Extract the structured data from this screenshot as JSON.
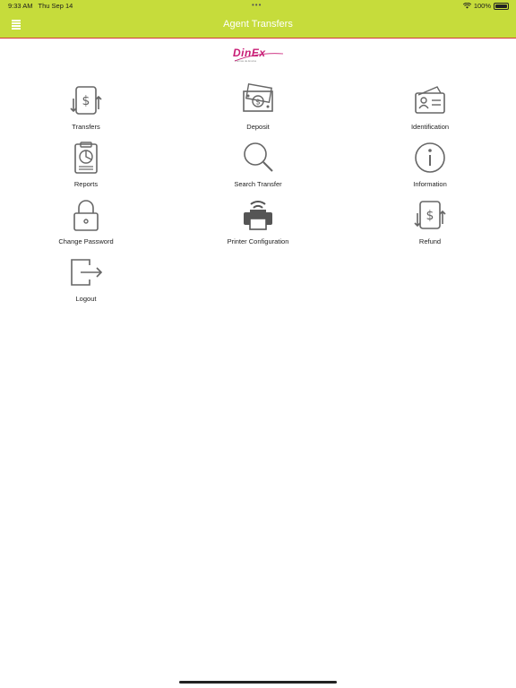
{
  "status_bar": {
    "time": "9:33 AM",
    "date": "Thu Sep 14",
    "battery": "100%"
  },
  "nav": {
    "title": "Agent Transfers"
  },
  "logo": {
    "text": "DinEx",
    "tagline": "Formas de Envios"
  },
  "menu": [
    {
      "label": "Transfers",
      "icon": "transfer-dollar-icon"
    },
    {
      "label": "Deposit",
      "icon": "cash-deposit-icon"
    },
    {
      "label": "Identification",
      "icon": "id-card-icon"
    },
    {
      "label": "Reports",
      "icon": "clipboard-report-icon"
    },
    {
      "label": "Search Transfer",
      "icon": "magnifier-icon"
    },
    {
      "label": "Information",
      "icon": "info-icon"
    },
    {
      "label": "Change Password",
      "icon": "padlock-icon"
    },
    {
      "label": "Printer Configuration",
      "icon": "wifi-printer-icon"
    },
    {
      "label": "Refund",
      "icon": "refund-dollar-icon"
    },
    {
      "label": "Logout",
      "icon": "logout-icon"
    }
  ]
}
